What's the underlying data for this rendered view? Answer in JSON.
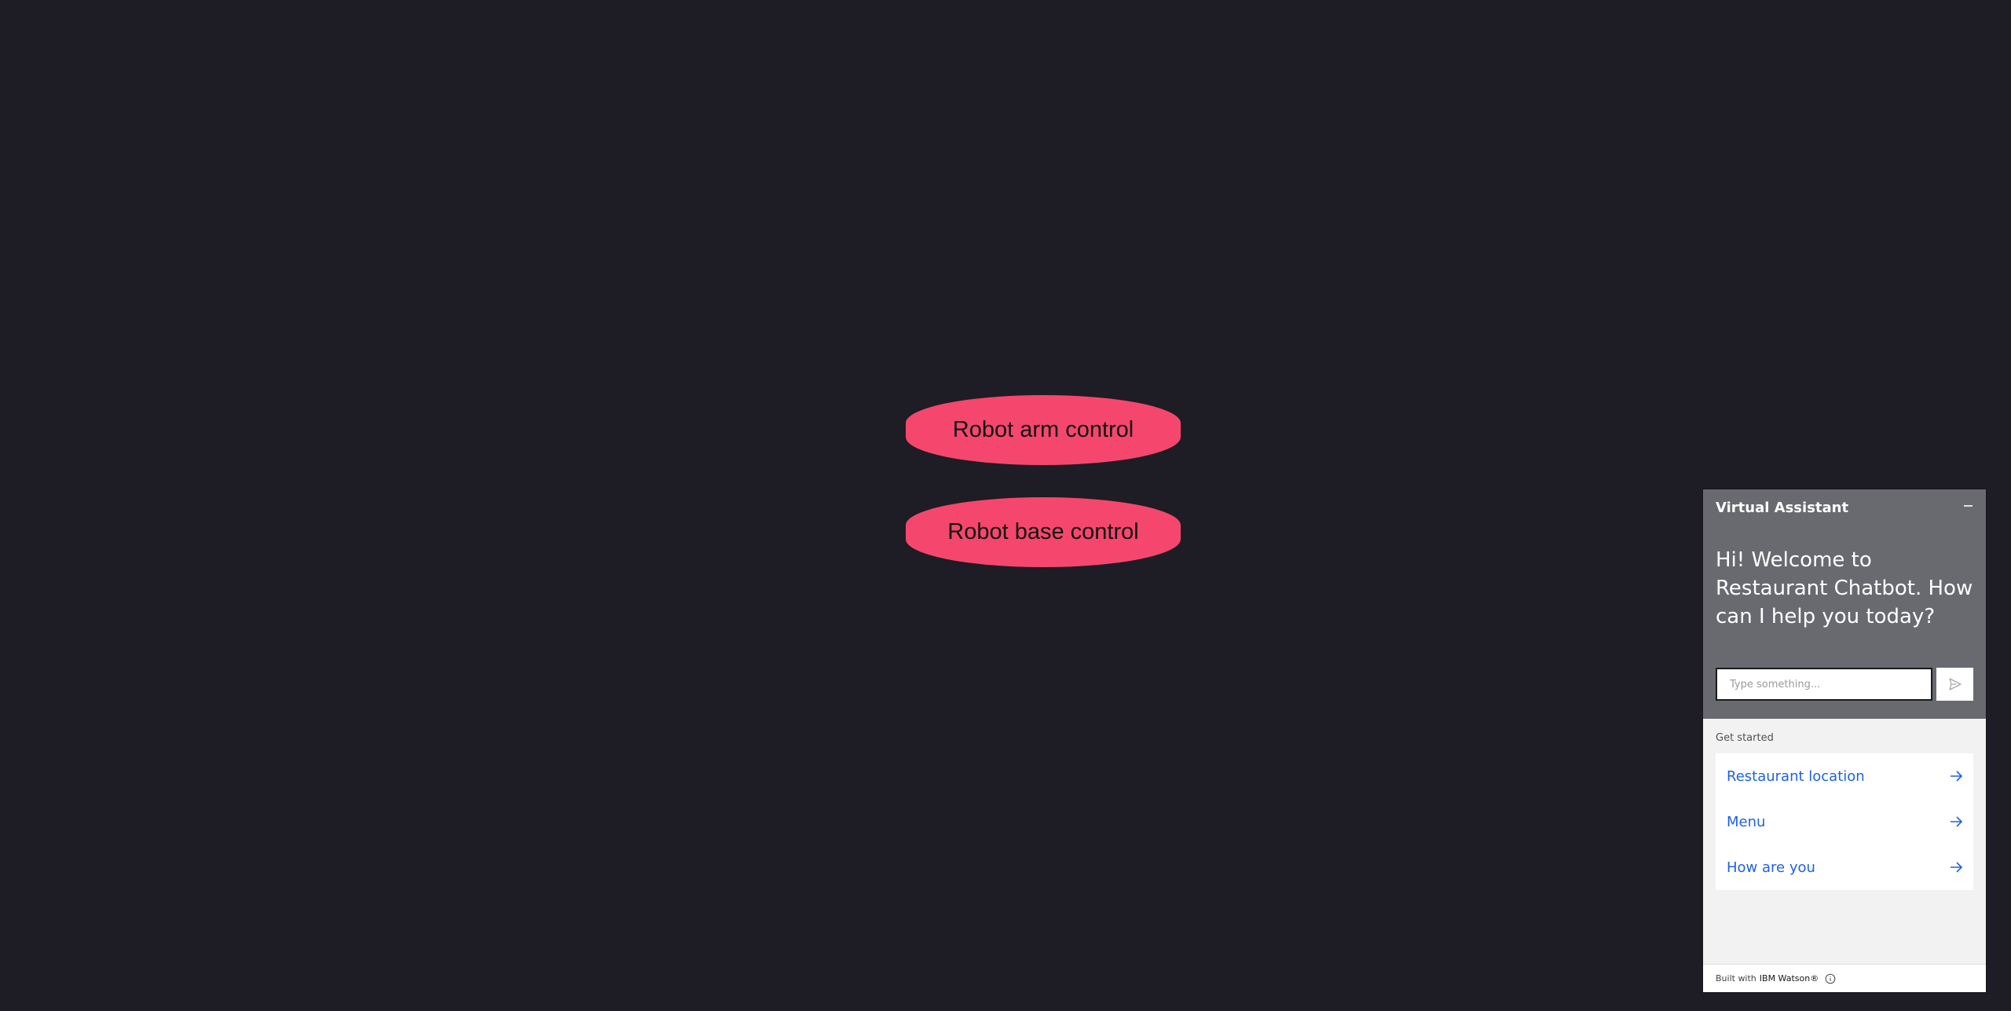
{
  "main": {
    "arm_button": "Robot arm control",
    "base_button": "Robot base control"
  },
  "chat": {
    "title": "Virtual Assistant",
    "welcome": "Hi! Welcome to Restaurant Chatbot. How can I help you today?",
    "input_placeholder": "Type something...",
    "get_started": "Get started",
    "options": [
      {
        "label": "Restaurant location"
      },
      {
        "label": "Menu"
      },
      {
        "label": "How are you"
      }
    ],
    "footer_prefix": "Built with",
    "footer_brand": "IBM Watson®"
  },
  "colors": {
    "background": "#1e1c24",
    "button": "#f5476d",
    "chat_header": "#686a70",
    "link": "#1f62e3"
  },
  "icons": {
    "minimize": "minimize-icon",
    "send": "send-icon",
    "arrow": "arrow-right-icon",
    "info": "info-icon"
  }
}
